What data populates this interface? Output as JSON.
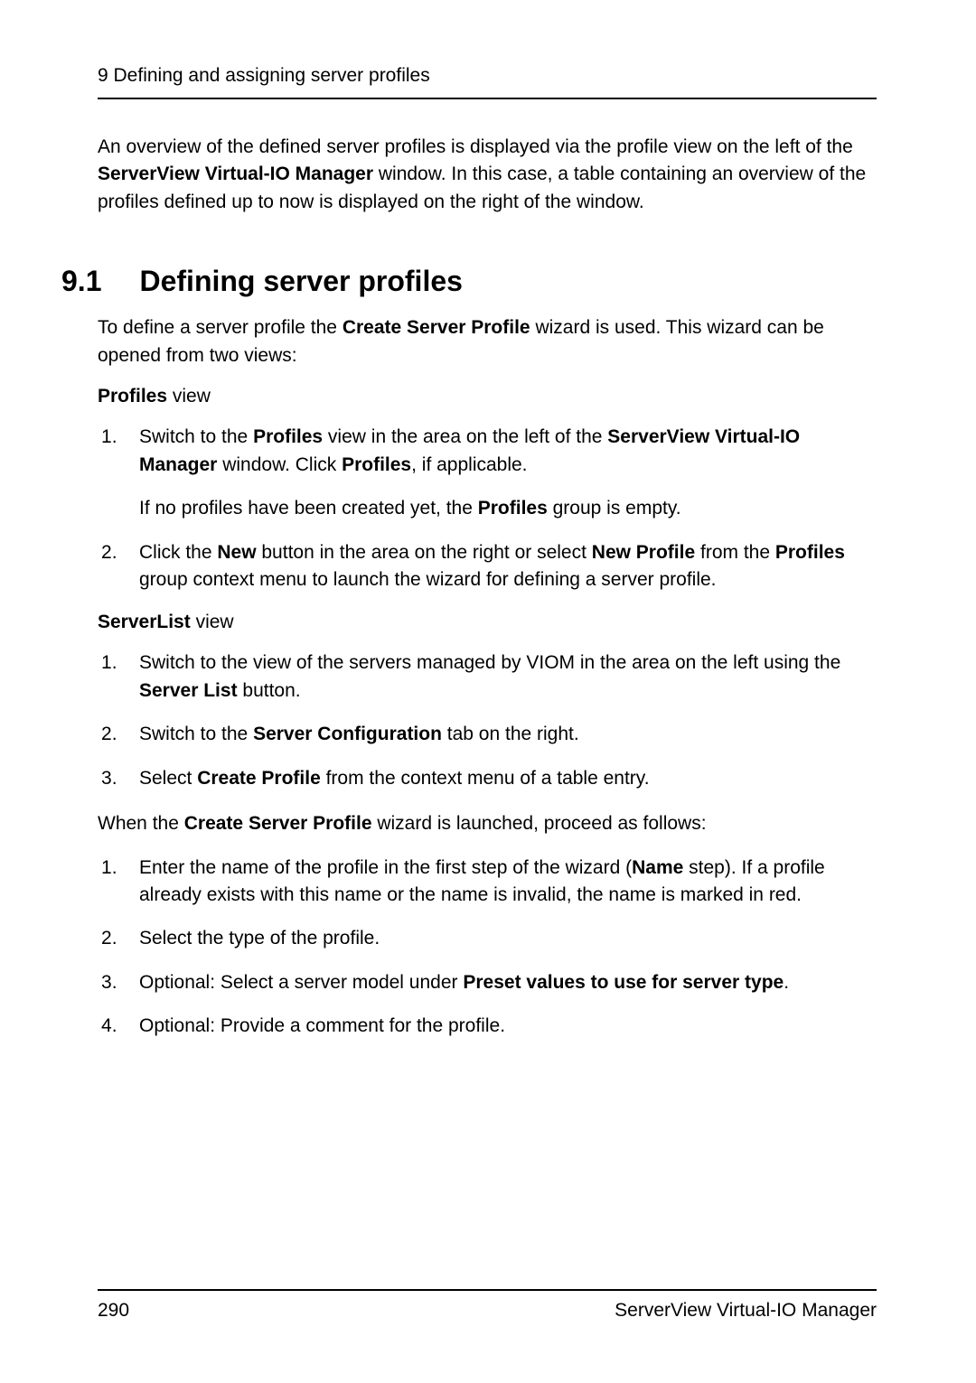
{
  "header": "9 Defining and assigning server profiles",
  "intro": {
    "p1_a": "An overview of the defined server profiles is displayed via the profile view on the left of the ",
    "p1_b": "ServerView Virtual-IO Manager",
    "p1_c": " window. In this case, a table containing an overview of the profiles defined up to now is displayed on the right of the window."
  },
  "section": {
    "num": "9.1",
    "title": "Defining server profiles"
  },
  "para1": {
    "a": "To define a server profile the ",
    "b": "Create Server Profile",
    "c": " wizard is used. This wizard can be opened from two views:"
  },
  "profiles_view": {
    "label_a": "Profiles",
    "label_b": " view"
  },
  "list1": {
    "i1": {
      "a": "Switch to the ",
      "b": "Profiles",
      "c": " view in the area on the left of the ",
      "d": "ServerView Virtual-IO Manager",
      "e": " window. Click ",
      "f": "Profiles",
      "g": ", if applicable.",
      "sub_a": "If no profiles have been created yet, the ",
      "sub_b": "Profiles",
      "sub_c": " group is empty."
    },
    "i2": {
      "a": "Click the ",
      "b": "New",
      "c": " button in the area on the right or select ",
      "d": "New Profile",
      "e": " from the ",
      "f": "Profiles",
      "g": " group context menu to launch the wizard for defining a server profile."
    }
  },
  "serverlist_view": {
    "label_a": "ServerList",
    "label_b": " view"
  },
  "list2": {
    "i1": {
      "a": "Switch to the view of the servers managed by VIOM in the area on the left using the ",
      "b": "Server List",
      "c": " button."
    },
    "i2": {
      "a": "Switch to the ",
      "b": "Server Configuration",
      "c": " tab on the right."
    },
    "i3": {
      "a": "Select ",
      "b": "Create Profile",
      "c": " from the context menu of a table entry."
    }
  },
  "para2": {
    "a": "When the ",
    "b": "Create Server Profile",
    "c": " wizard is launched, proceed as follows:"
  },
  "list3": {
    "i1": {
      "a": "Enter the name of the profile in the first step of the wizard (",
      "b": "Name",
      "c": " step). If a profile already exists with this name or the name is invalid, the name is marked in red."
    },
    "i2": {
      "a": "Select the type of the profile."
    },
    "i3": {
      "a": "Optional: Select a server model under ",
      "b": "Preset values to use for server type",
      "c": "."
    },
    "i4": {
      "a": "Optional: Provide a comment for the profile."
    }
  },
  "footer": {
    "page": "290",
    "doc": "ServerView Virtual-IO Manager"
  }
}
